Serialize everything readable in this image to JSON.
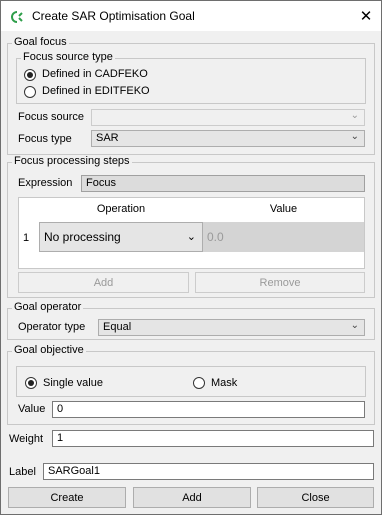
{
  "window": {
    "title": "Create SAR Optimisation Goal",
    "close_glyph": "✕"
  },
  "goal_focus": {
    "title": "Goal focus",
    "focus_source_type": {
      "title": "Focus source type",
      "options": [
        {
          "label": "Defined in CADFEKO",
          "selected": true
        },
        {
          "label": "Defined in EDITFEKO",
          "selected": false
        }
      ]
    },
    "focus_source": {
      "label": "Focus source",
      "value": ""
    },
    "focus_type": {
      "label": "Focus type",
      "value": "SAR"
    }
  },
  "focus_processing": {
    "title": "Focus processing steps",
    "expression_label": "Expression",
    "expression_value": "Focus",
    "table": {
      "columns": [
        "Operation",
        "Value"
      ],
      "rows": [
        {
          "index": "1",
          "operation": "No processing",
          "value": "0.0"
        }
      ]
    },
    "add_label": "Add",
    "remove_label": "Remove"
  },
  "goal_operator": {
    "title": "Goal operator",
    "operator_type_label": "Operator type",
    "operator_type_value": "Equal"
  },
  "goal_objective": {
    "title": "Goal objective",
    "options": [
      {
        "label": "Single value",
        "selected": true
      },
      {
        "label": "Mask",
        "selected": false
      }
    ],
    "value_label": "Value",
    "value": "0"
  },
  "weight": {
    "label": "Weight",
    "value": "1"
  },
  "goal_label": {
    "label": "Label",
    "value": "SARGoal1"
  },
  "footer": {
    "create_label": "Create",
    "add_label": "Add",
    "close_label": "Close"
  },
  "icons": {
    "app": "cadfeko-app-icon",
    "dropdown": "chevron-down-icon"
  }
}
